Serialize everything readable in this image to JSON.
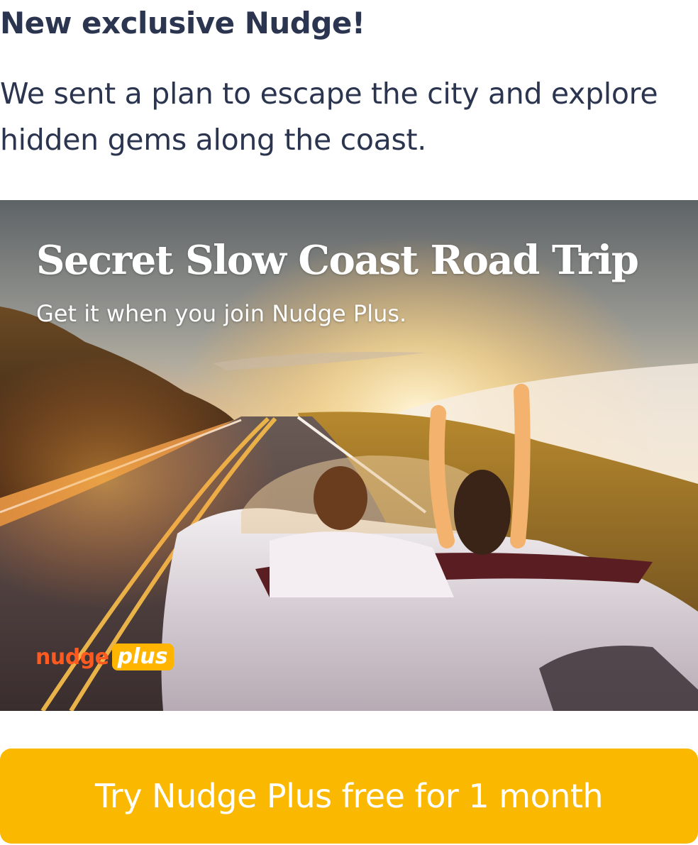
{
  "header": {
    "headline": "New exclusive Nudge!",
    "body": "We sent a plan to escape the city and explore hidden gems along the coast."
  },
  "promo": {
    "title": "Secret Slow Coast Road Trip",
    "subtitle": "Get it when you join Nudge Plus.",
    "image_subject": "couple in convertible on coastal road at sunset",
    "brand": {
      "word": "nudge",
      "badge": "plus"
    }
  },
  "cta": {
    "label": "Try Nudge Plus free for 1 month"
  },
  "colors": {
    "text": "#2b3550",
    "cta_background": "#fbb800",
    "brand_orange": "#ff5a1f",
    "brand_badge": "#ffb400"
  }
}
